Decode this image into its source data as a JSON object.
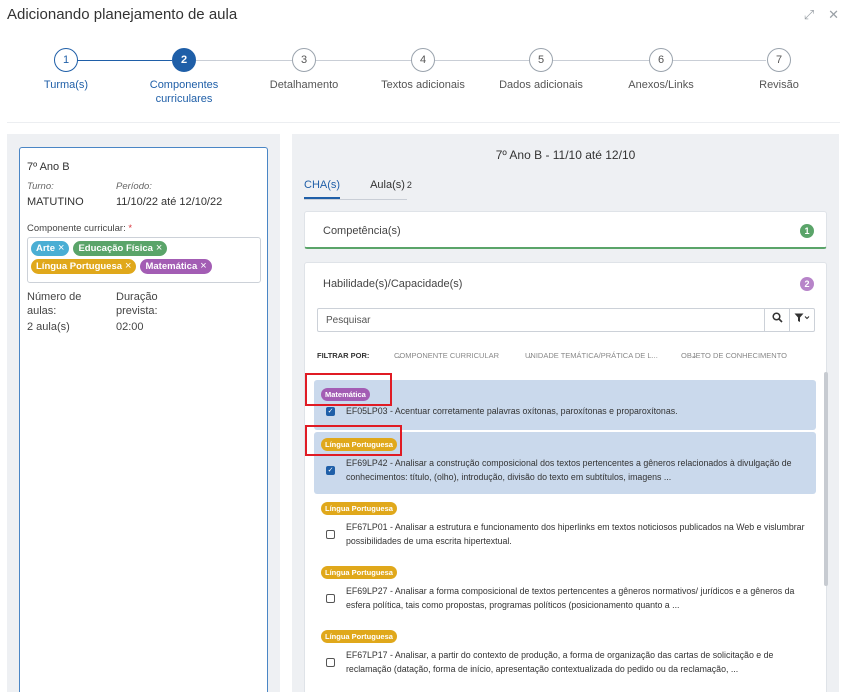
{
  "window": {
    "title": "Adicionando planejamento de aula",
    "expand_icon": "⤢",
    "close_icon": "✕"
  },
  "stepper": [
    {
      "num": "1",
      "label": "Turma(s)",
      "state": "done"
    },
    {
      "num": "2",
      "label": "Componentes\ncurriculares",
      "state": "active"
    },
    {
      "num": "3",
      "label": "Detalhamento",
      "state": "todo"
    },
    {
      "num": "4",
      "label": "Textos adicionais",
      "state": "todo"
    },
    {
      "num": "5",
      "label": "Dados adicionais",
      "state": "todo"
    },
    {
      "num": "6",
      "label": "Anexos/Links",
      "state": "todo"
    },
    {
      "num": "7",
      "label": "Revisão",
      "state": "todo"
    }
  ],
  "left": {
    "class_name": "7º Ano B",
    "shift_label": "Turno:",
    "shift_value": "MATUTINO",
    "period_label": "Período:",
    "period_value": "11/10/22 até 12/10/22",
    "component_label": "Componente curricular:",
    "required_mark": "*",
    "tags": [
      {
        "label": "Arte",
        "color": "#4aaed4"
      },
      {
        "label": "Educação Física",
        "color": "#5aa469"
      },
      {
        "label": "Língua Portuguesa",
        "color": "#e0a81b"
      },
      {
        "label": "Matemática",
        "color": "#a35db4"
      }
    ],
    "lessons_label": "Número de\naulas:",
    "lessons_value": "2 aula(s)",
    "duration_label": "Duração\nprevista:",
    "duration_value": "02:00"
  },
  "right": {
    "heading": "7º Ano B - 11/10 até 12/10",
    "tabs": [
      {
        "label": "CHA(s)",
        "count": ""
      },
      {
        "label": "Aula(s)",
        "count": "2"
      }
    ],
    "competencia": {
      "title": "Competência(s)",
      "count": "1",
      "color": "#5aa469"
    },
    "habilidades": {
      "title": "Habilidade(s)/Capacidade(s)",
      "count": "2",
      "color": "#b784c9"
    },
    "search_placeholder": "Pesquisar",
    "search_icon": "⌕",
    "filter_icon": "▼",
    "filter": {
      "label": "FILTRAR POR:",
      "options": [
        "COMPONENTE CURRICULAR",
        "UNIDADE TEMÁTICA/PRÁTICA DE L...",
        "OBJETO DE CONHECIMENTO"
      ]
    },
    "items": [
      {
        "subject": "Matemática",
        "color": "#a35db4",
        "checked": true,
        "code": "EF05LP03",
        "text": " - Acentuar corretamente palavras oxítonas, paroxítonas e proparoxítonas."
      },
      {
        "subject": "Língua Portuguesa",
        "color": "#e0a81b",
        "checked": true,
        "code": "EF69LP42",
        "text": " - Analisar a construção composicional dos textos pertencentes a gêneros relacionados à divulgação de conhecimentos: título, (olho), introdução, divisão do texto em subtítulos, imagens ..."
      },
      {
        "subject": "Língua Portuguesa",
        "color": "#e0a81b",
        "checked": false,
        "code": "EF67LP01",
        "text": " - Analisar a estrutura e funcionamento dos hiperlinks em textos noticiosos publicados na Web e vislumbrar possibilidades de uma escrita hipertextual."
      },
      {
        "subject": "Língua Portuguesa",
        "color": "#e0a81b",
        "checked": false,
        "code": "EF69LP27",
        "text": " - Analisar a forma composicional de textos pertencentes a gêneros normativos/ jurídicos e a gêneros da esfera política, tais como propostas, programas políticos (posicionamento quanto a ..."
      },
      {
        "subject": "Língua Portuguesa",
        "color": "#e0a81b",
        "checked": false,
        "code": "EF67LP17",
        "text": " - Analisar, a partir do contexto de produção, a forma de organização das cartas de solicitação e de reclamação (datação, forma de início, apresentação contextualizada do pedido ou da reclamação, ..."
      }
    ]
  }
}
